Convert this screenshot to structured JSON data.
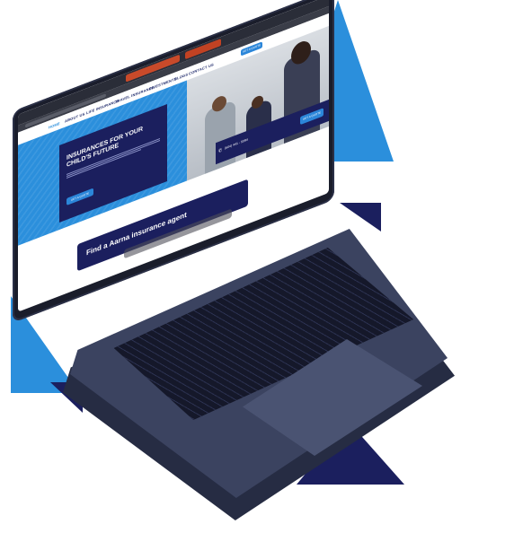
{
  "colors": {
    "accent_blue": "#2b8fdc",
    "navy": "#1b1f5e",
    "laptop_body": "#3b4360",
    "laptop_edge": "#262c43"
  },
  "site": {
    "nav": {
      "items": [
        "HOME",
        "ABOUT US",
        "LIFE INSURANCE",
        "TRAVEL INSURANCE",
        "INVESTMENTS",
        "BLOGS",
        "CONTACT US"
      ],
      "cta": "GET A QUOTE"
    },
    "hero": {
      "title_line1": "INSURANCES FOR YOUR",
      "title_line2": "CHILD'S FUTURE",
      "button": "GET A QUOTE"
    },
    "contact": {
      "phone": "(604) 441 - 5094",
      "cta": "GET A QUOTE"
    },
    "agent_banner": "Find a Aarna insurance agent"
  },
  "icons": [
    "phone-icon"
  ]
}
